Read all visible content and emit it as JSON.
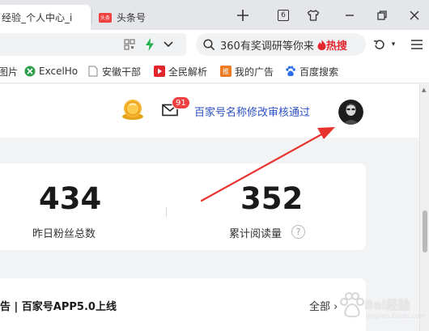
{
  "browser": {
    "tabs": [
      {
        "label": "经验_个人中心_i",
        "active": true
      },
      {
        "label": "头条号",
        "icon": "toutiao-logo",
        "icon_text": "头条",
        "active": false
      }
    ],
    "tab_count": "6",
    "search": {
      "text": "360有奖调研等你来",
      "hot_label": "热搜"
    },
    "bookmarks": [
      {
        "label": "图片",
        "icon": "image-icon"
      },
      {
        "label": "ExcelHo",
        "icon": "excel-icon"
      },
      {
        "label": "安徽干部",
        "icon": "page-icon"
      },
      {
        "label": "全民解析",
        "icon": "play-icon"
      },
      {
        "label": "我的广告",
        "icon": "ad-icon",
        "icon_text": "推"
      },
      {
        "label": "百度搜索",
        "icon": "baidu-paw-icon"
      }
    ]
  },
  "header": {
    "message_badge": "91",
    "notice_link": "百家号名称修改审核通过"
  },
  "stats": [
    {
      "value": "434",
      "label": "昨日粉丝总数"
    },
    {
      "value": "352",
      "label": "累计阅读量"
    }
  ],
  "help_icon_text": "?",
  "announcement": {
    "text": "告 | 百家号APP5.0上线",
    "all_link": "全部"
  },
  "watermark": {
    "text": "Bai经验",
    "sub": "jingyan.baidu.com"
  },
  "colors": {
    "link_blue": "#2c4fc5",
    "badge_red": "#f04142",
    "arrow_red": "#e8322e"
  }
}
